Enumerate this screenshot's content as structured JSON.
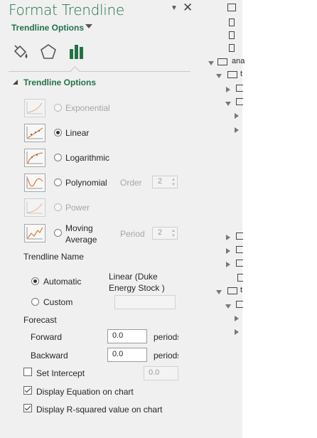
{
  "pane": {
    "title": "Format Trendline",
    "subtitle": "Trendline Options",
    "tabs": [
      {
        "name": "fill-line-icon"
      },
      {
        "name": "effects-icon"
      },
      {
        "name": "trendline-options-icon"
      }
    ],
    "section_title": "Trendline Options",
    "types": [
      {
        "label": "Exponential",
        "selected": false,
        "enabled": false
      },
      {
        "label": "Linear",
        "selected": true,
        "enabled": true
      },
      {
        "label": "Logarithmic",
        "selected": false,
        "enabled": true
      },
      {
        "label": "Polynomial",
        "selected": false,
        "enabled": true
      },
      {
        "label": "Power",
        "selected": false,
        "enabled": false
      },
      {
        "label_line1": "Moving",
        "label_line2": "Average",
        "selected": false,
        "enabled": true
      }
    ],
    "order": {
      "label": "Order",
      "value": "2"
    },
    "period": {
      "label": "Period",
      "value": "2"
    },
    "trendline_name": {
      "heading": "Trendline Name",
      "automatic_label": "Automatic",
      "automatic_value_line1": "Linear (Duke",
      "automatic_value_line2": "Energy Stock )",
      "custom_label": "Custom",
      "custom_value": ""
    },
    "forecast": {
      "heading": "Forecast",
      "forward_label": "Forward",
      "forward_value": "0.0",
      "forward_unit": "periods",
      "backward_label": "Backward",
      "backward_value": "0.0",
      "backward_unit": "periods"
    },
    "set_intercept": {
      "label": "Set Intercept",
      "checked": false,
      "value": "0.0"
    },
    "display_equation": {
      "label": "Display Equation on chart",
      "checked": true
    },
    "display_rsquared": {
      "label": "Display R-squared value on chart",
      "checked": true
    }
  },
  "tree": {
    "folder_label": "ana",
    "subfolder_letter": "t"
  },
  "colors": {
    "accent": "#217346",
    "pane_bg": "#f0f0f0",
    "trend_orange": "#e07b39"
  }
}
